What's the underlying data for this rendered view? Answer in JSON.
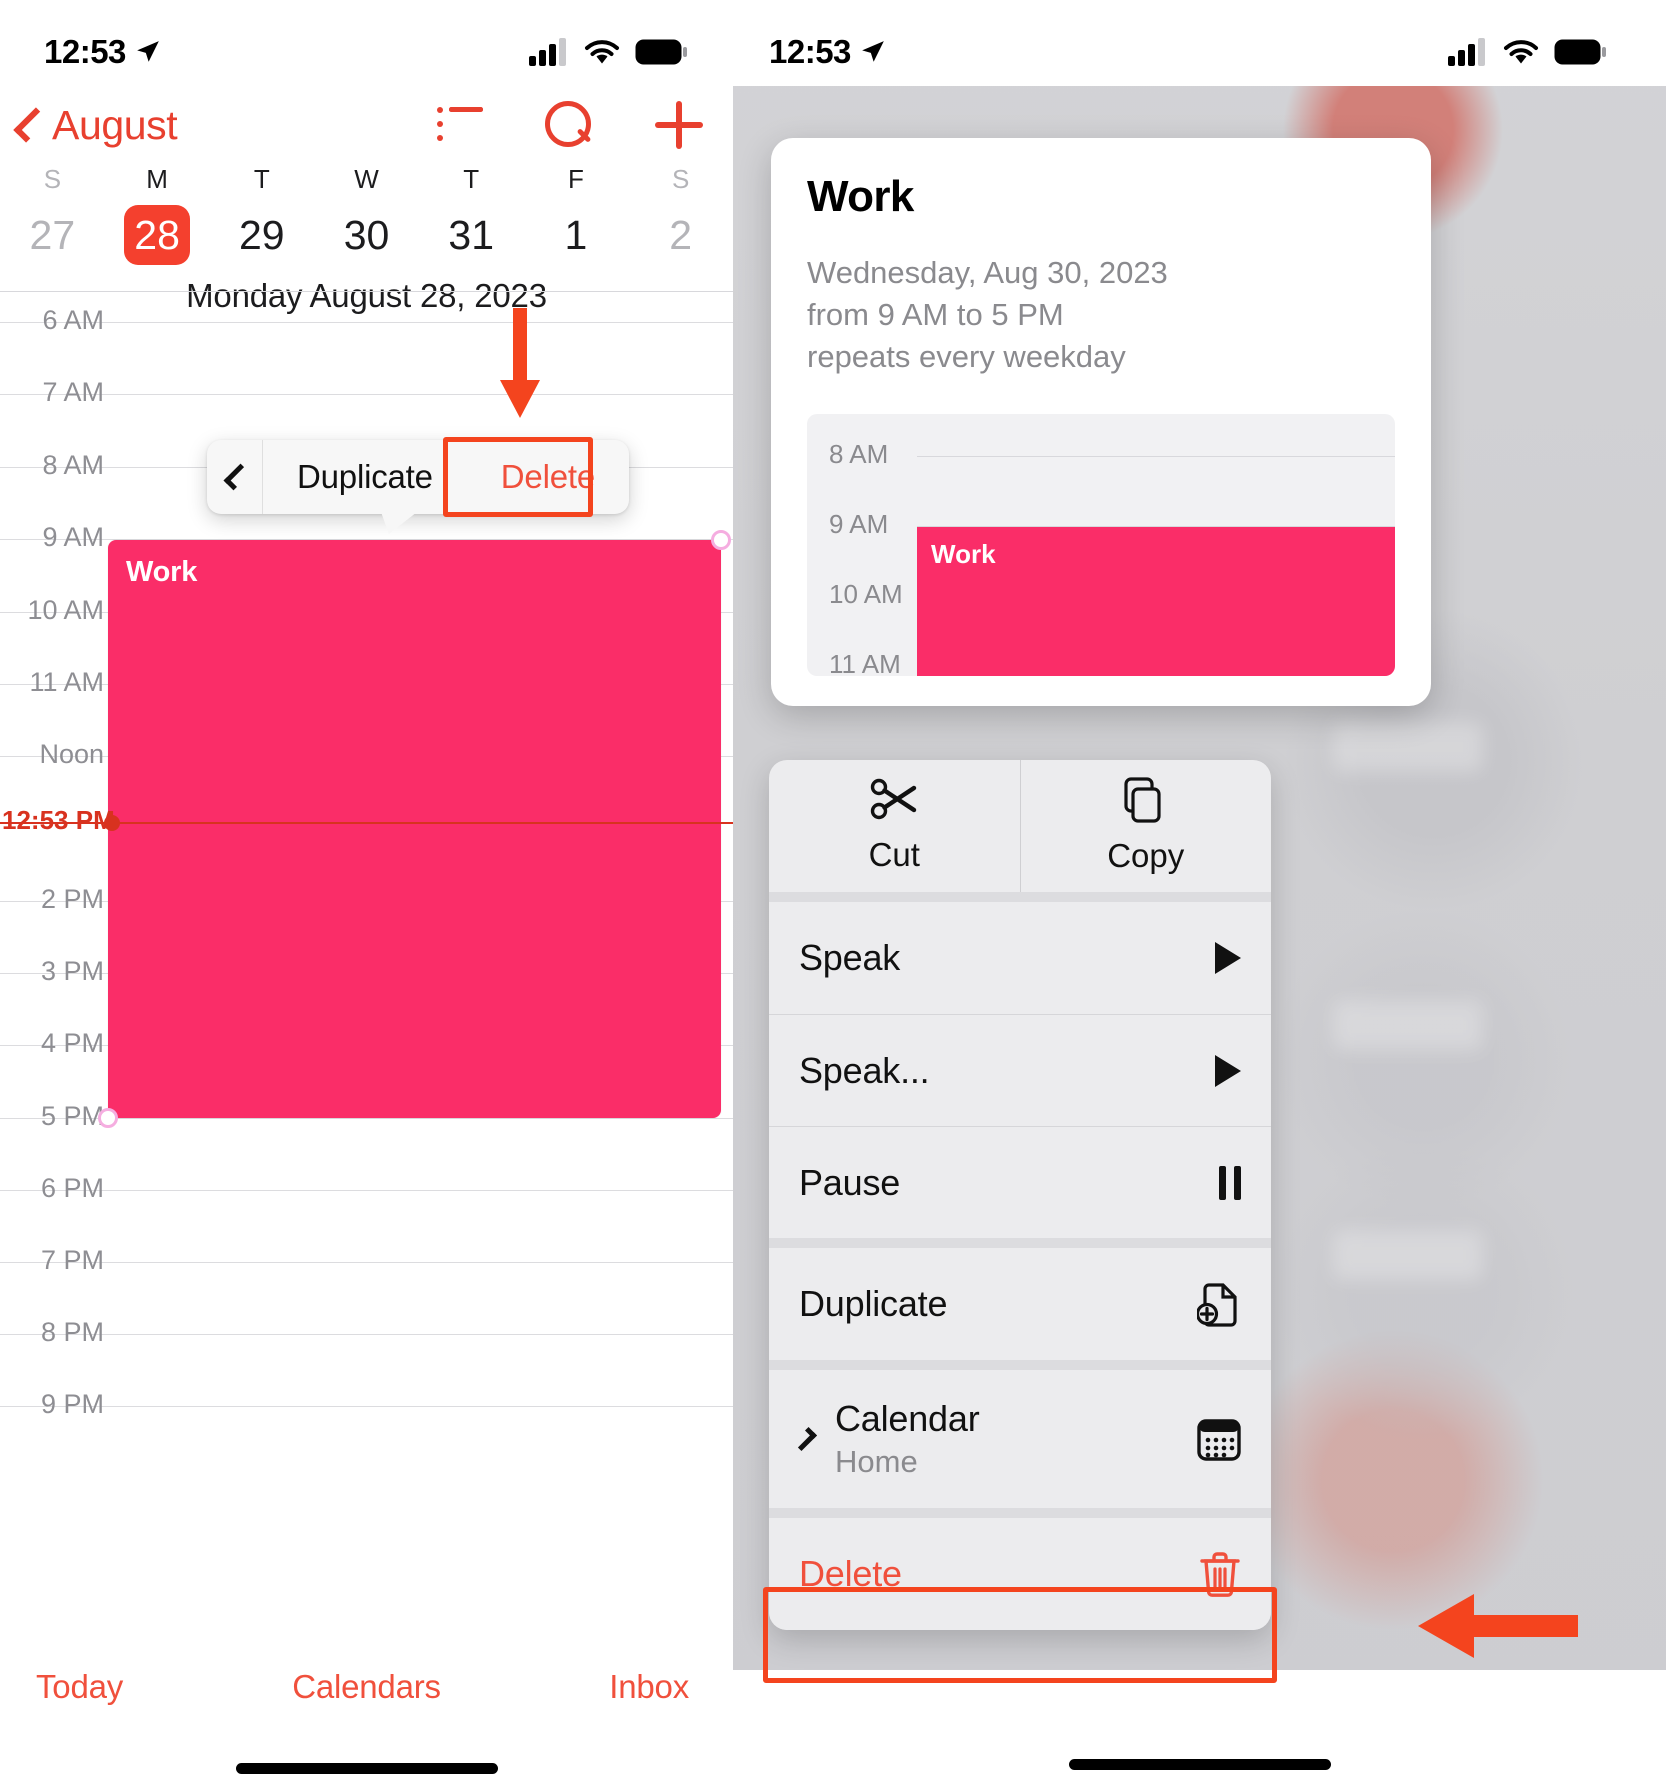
{
  "left": {
    "status": {
      "time": "12:53",
      "location_icon": "location-arrow-icon",
      "cellular_icon": "cellular-bars-icon",
      "wifi_icon": "wifi-icon",
      "battery_icon": "battery-full-icon"
    },
    "nav": {
      "back_label": "August",
      "list_icon": "list-bullet-icon",
      "search_icon": "search-icon",
      "add_icon": "plus-icon"
    },
    "week": {
      "days": [
        {
          "dow": "S",
          "num": "27",
          "dim": true,
          "today": false
        },
        {
          "dow": "M",
          "num": "28",
          "dim": false,
          "today": true
        },
        {
          "dow": "T",
          "num": "29",
          "dim": false,
          "today": false
        },
        {
          "dow": "W",
          "num": "30",
          "dim": false,
          "today": false
        },
        {
          "dow": "T",
          "num": "31",
          "dim": false,
          "today": false
        },
        {
          "dow": "F",
          "num": "1",
          "dim": false,
          "today": false
        },
        {
          "dow": "S",
          "num": "2",
          "dim": true,
          "today": false
        }
      ],
      "day_title": "Monday  August 28, 2023"
    },
    "hours": [
      "6 AM",
      "7 AM",
      "8 AM",
      "9 AM",
      "10 AM",
      "11 AM",
      "Noon",
      "2 PM",
      "3 PM",
      "4 PM",
      "5 PM",
      "6 PM",
      "7 PM",
      "8 PM",
      "9 PM"
    ],
    "now_label": "12:53 PM",
    "event": {
      "title": "Work"
    },
    "popover": {
      "back_icon": "chevron-left-icon",
      "duplicate_label": "Duplicate",
      "delete_label": "Delete"
    },
    "tabs": [
      {
        "label": "Today"
      },
      {
        "label": "Calendars"
      },
      {
        "label": "Inbox"
      }
    ]
  },
  "right": {
    "status": {
      "time": "12:53",
      "location_icon": "location-arrow-icon",
      "cellular_icon": "cellular-bars-icon",
      "wifi_icon": "wifi-icon",
      "battery_icon": "battery-full-icon"
    },
    "preview": {
      "title": "Work",
      "date_line": "Wednesday, Aug 30, 2023",
      "time_line": "from 9 AM to 5 PM",
      "repeat_line": "repeats every weekday",
      "mini_hours": [
        "8 AM",
        "9 AM",
        "10 AM",
        "11 AM"
      ],
      "mini_event_title": "Work"
    },
    "menu": {
      "top_actions": [
        {
          "label": "Cut",
          "icon": "scissors-icon"
        },
        {
          "label": "Copy",
          "icon": "copy-icon"
        }
      ],
      "rows": [
        {
          "label": "Speak",
          "icon": "play-triangle-icon",
          "sub": "",
          "lead": "",
          "danger": false
        },
        {
          "label": "Speak...",
          "icon": "play-triangle-icon",
          "sub": "",
          "lead": "",
          "danger": false
        },
        {
          "label": "Pause",
          "icon": "pause-icon",
          "sub": "",
          "lead": "",
          "danger": false
        },
        {
          "label": "Duplicate",
          "icon": "duplicate-doc-icon",
          "sub": "",
          "lead": "",
          "danger": false
        },
        {
          "label": "Calendar",
          "icon": "calendar-icon",
          "sub": "Home",
          "lead": "chevron-right-icon",
          "danger": false
        },
        {
          "label": "Delete",
          "icon": "trash-icon",
          "sub": "",
          "lead": "",
          "danger": true
        }
      ]
    }
  },
  "annotations": {
    "arrow_down_color": "#f4441e",
    "arrow_left_color": "#f4441e",
    "highlight_color": "#f4441e"
  },
  "colors": {
    "accent_red": "#f0503c",
    "today_red": "#f4402e",
    "event_pink": "#fa2d68",
    "now_red": "#d8321f",
    "grid_gray": "#dcdcdf",
    "label_gray": "#8e8e93"
  }
}
